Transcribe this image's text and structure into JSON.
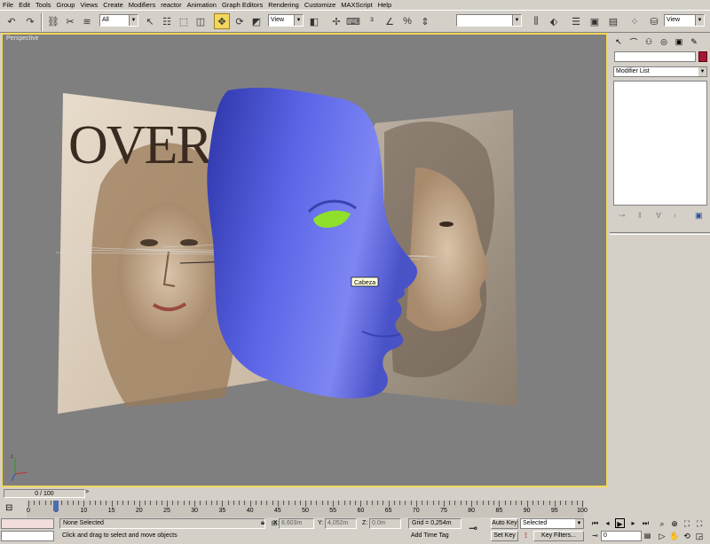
{
  "menu": [
    "File",
    "Edit",
    "Tools",
    "Group",
    "Views",
    "Create",
    "Modifiers",
    "reactor",
    "Animation",
    "Graph Editors",
    "Rendering",
    "Customize",
    "MAXScript",
    "Help"
  ],
  "toolbar": {
    "selection_filter": "All",
    "reference_coord": "View",
    "named_selection": "",
    "right_view": "View"
  },
  "viewport": {
    "label": "Perspective",
    "object_tooltip": "Cabeza",
    "magazine_text": "OVER"
  },
  "command_panel": {
    "object_name": "",
    "modifier_list": "Modifier List"
  },
  "time_slider": {
    "label": "0 / 100",
    "arrow": ">"
  },
  "track": {
    "ticks": [
      "0",
      "5",
      "10",
      "15",
      "20",
      "25",
      "30",
      "35",
      "40",
      "45",
      "50",
      "55",
      "60",
      "65",
      "70",
      "75",
      "80",
      "85",
      "90",
      "95",
      "100"
    ]
  },
  "status": {
    "selection": "None Selected",
    "prompt": "Click and drag to select and move objects",
    "x_label": "X:",
    "x_value": "8,603m",
    "y_label": "Y:",
    "y_value": "4,052m",
    "z_label": "Z:",
    "z_value": "0,0m",
    "grid": "Grid = 0,254m",
    "add_time_tag": "Add Time Tag",
    "auto_key": "Auto Key",
    "set_key": "Set Key",
    "selected": "Selected",
    "key_filters": "Key Filters...",
    "frame": "0"
  },
  "colors": {
    "viewport_bg": "#7f7f7f",
    "active_border": "#f2d75c",
    "mask": "#5a63e0",
    "eye": "#8ee02a",
    "object_color": "#a1173a"
  }
}
